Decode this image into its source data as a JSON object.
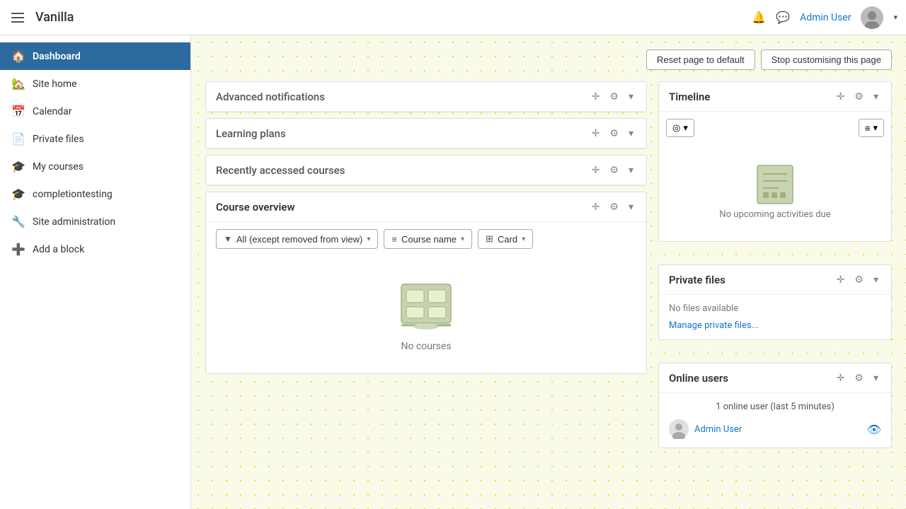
{
  "navbar": {
    "brand": "Vanilla",
    "user_name": "Admin User",
    "bell_title": "Notifications",
    "chat_title": "Messages"
  },
  "sidebar": {
    "items": [
      {
        "id": "dashboard",
        "label": "Dashboard",
        "icon": "🏠",
        "active": true
      },
      {
        "id": "site-home",
        "label": "Site home",
        "icon": "🏡",
        "active": false
      },
      {
        "id": "calendar",
        "label": "Calendar",
        "icon": "📅",
        "active": false
      },
      {
        "id": "private-files",
        "label": "Private files",
        "icon": "📄",
        "active": false
      },
      {
        "id": "my-courses",
        "label": "My courses",
        "icon": "🎓",
        "active": false
      },
      {
        "id": "completiontesting",
        "label": "completiontesting",
        "icon": "🎓",
        "active": false
      },
      {
        "id": "site-administration",
        "label": "Site administration",
        "icon": "🔧",
        "active": false
      },
      {
        "id": "add-block",
        "label": "Add a block",
        "icon": "➕",
        "active": false
      }
    ]
  },
  "page_actions": {
    "reset_label": "Reset page to default",
    "stop_label": "Stop customising this page"
  },
  "blocks": {
    "advanced_notifications": {
      "title": "Advanced notifications"
    },
    "learning_plans": {
      "title": "Learning plans"
    },
    "recently_accessed": {
      "title": "Recently accessed courses"
    },
    "course_overview": {
      "title": "Course overview",
      "filter_label": "All (except removed from view)",
      "sort_label": "Course name",
      "view_label": "Card",
      "no_courses": "No courses"
    },
    "timeline": {
      "title": "Timeline",
      "filter_btn": "◎",
      "sort_btn": "≡",
      "no_activities": "No upcoming activities due"
    },
    "private_files": {
      "title": "Private files",
      "no_files": "No files available",
      "manage_link": "Manage private files..."
    },
    "online_users": {
      "title": "Online users",
      "count_text": "1 online user (last 5 minutes)",
      "user_name": "Admin User"
    }
  },
  "icons": {
    "move": "✛",
    "gear": "⚙",
    "chevron_down": "▾",
    "filter": "▼",
    "sort_list": "≡",
    "grid": "⊞"
  }
}
